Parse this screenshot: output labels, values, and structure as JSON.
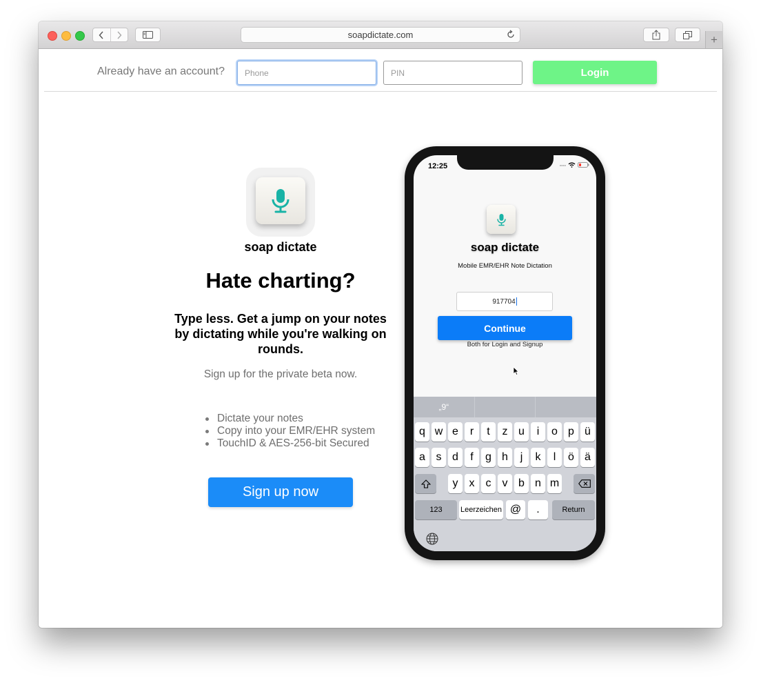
{
  "browser": {
    "url": "soapdictate.com"
  },
  "login": {
    "prompt": "Already have an account?",
    "phone_placeholder": "Phone",
    "pin_placeholder": "PIN",
    "button": "Login"
  },
  "hero": {
    "brand": "soap dictate",
    "headline": "Hate charting?",
    "subheadline": "Type less. Get a jump on your notes by dictating while you're walking on rounds.",
    "beta_text": "Sign up for the private beta now.",
    "features": [
      "Dictate your notes",
      "Copy into your EMR/EHR system",
      "TouchID & AES-256-bit Secured"
    ],
    "cta": "Sign up now"
  },
  "phone": {
    "time": "12:25",
    "brand": "soap dictate",
    "tagline": "Mobile EMR/EHR Note Dictation",
    "code_value": "917704",
    "continue_label": "Continue",
    "note": "Both for Login and Signup",
    "keyboard": {
      "suggestions": [
        "„9“",
        "",
        ""
      ],
      "row1": [
        "q",
        "w",
        "e",
        "r",
        "t",
        "z",
        "u",
        "i",
        "o",
        "p",
        "ü"
      ],
      "row2": [
        "a",
        "s",
        "d",
        "f",
        "g",
        "h",
        "j",
        "k",
        "l",
        "ö",
        "ä"
      ],
      "row3": [
        "y",
        "x",
        "c",
        "v",
        "b",
        "n",
        "m"
      ],
      "numbers_key": "123",
      "space_key": "Leerzeichen",
      "at_key": "@",
      "dot_key": ".",
      "return_key": "Return"
    }
  },
  "colors": {
    "login_button": "#6ef487",
    "cta_button": "#1b8cf8",
    "continue_button": "#0b7cf8",
    "mic_accent": "#19b3a6"
  }
}
